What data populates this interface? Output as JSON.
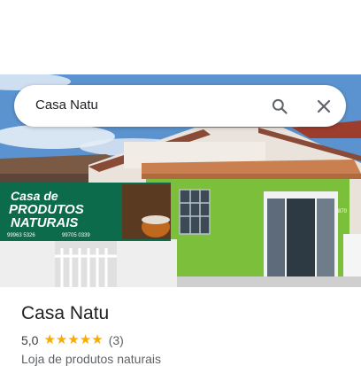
{
  "search": {
    "query": "Casa Natu"
  },
  "photo": {
    "sign_line1": "Casa de",
    "sign_line2": "PRODUTOS",
    "sign_line3": "NATURAIS",
    "sign_phone1": "99963 5326",
    "sign_phone2": "99705 0339",
    "sign_number": "870"
  },
  "place": {
    "name": "Casa Natu",
    "rating": "5,0",
    "rating_stars": 5,
    "reviews": "(3)",
    "category": "Loja de produtos naturais"
  },
  "icons": [
    "search-icon",
    "close-icon",
    "star-icon"
  ],
  "colors": {
    "star": "#f9ab00",
    "wall_green": "#7cbf3a",
    "sign_green": "#0b6b4b"
  }
}
